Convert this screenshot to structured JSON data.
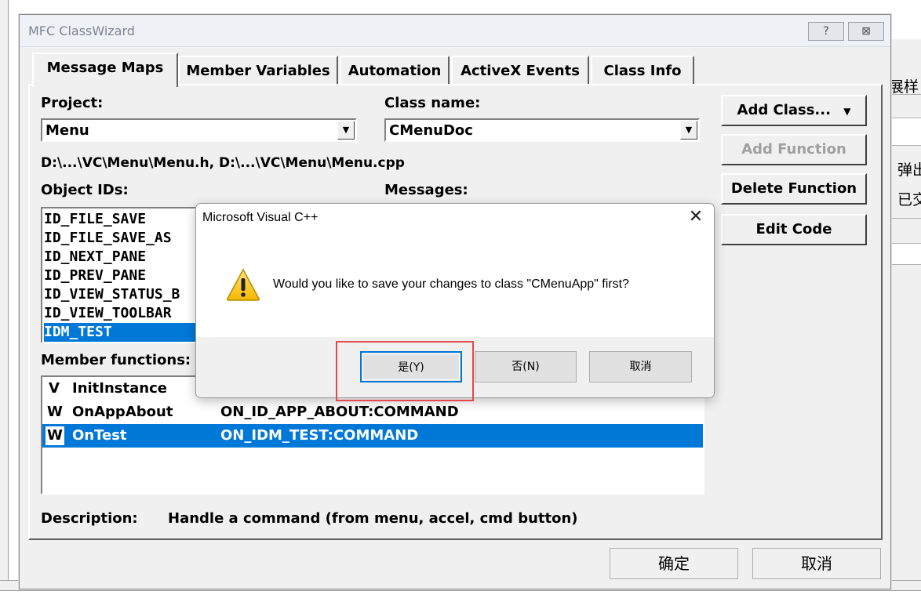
{
  "background": {
    "text_1": "展样",
    "text_2": "弹出",
    "text_3": "已交"
  },
  "wizard": {
    "title": "MFC ClassWizard",
    "help_button": "?",
    "close_button": "⊠",
    "tabs": [
      {
        "label": "Message Maps",
        "active": true
      },
      {
        "label": "Member Variables",
        "active": false
      },
      {
        "label": "Automation",
        "active": false
      },
      {
        "label": "ActiveX Events",
        "active": false
      },
      {
        "label": "Class Info",
        "active": false
      }
    ],
    "project_label": "Project:",
    "project_value": "Menu",
    "class_name_label": "Class name:",
    "class_name_value": "CMenuDoc",
    "file_path": "D:\\...\\VC\\Menu\\Menu.h, D:\\...\\VC\\Menu\\Menu.cpp",
    "object_ids_label": "Object IDs:",
    "messages_label": "Messages:",
    "object_ids": [
      {
        "id": "ID_FILE_SAVE",
        "selected": false
      },
      {
        "id": "ID_FILE_SAVE_AS",
        "selected": false
      },
      {
        "id": "ID_NEXT_PANE",
        "selected": false
      },
      {
        "id": "ID_PREV_PANE",
        "selected": false
      },
      {
        "id": "ID_VIEW_STATUS_B",
        "selected": false
      },
      {
        "id": "ID_VIEW_TOOLBAR",
        "selected": false
      },
      {
        "id": "IDM_TEST",
        "selected": true
      }
    ],
    "member_functions_label": "Member functions:",
    "member_functions": [
      {
        "type": "V",
        "name": "InitInstance",
        "handler": "",
        "selected": false
      },
      {
        "type": "W",
        "name": "OnAppAbout",
        "handler": "ON_ID_APP_ABOUT:COMMAND",
        "selected": false
      },
      {
        "type": "W",
        "name": "OnTest",
        "handler": "ON_IDM_TEST:COMMAND",
        "selected": true
      }
    ],
    "description_label": "Description:",
    "description_value": "Handle a command (from menu, accel, cmd button)",
    "buttons": {
      "add_class": "Add Class...",
      "add_function": "Add Function",
      "delete_function": "Delete Function",
      "edit_code": "Edit Code",
      "ok": "确定",
      "cancel": "取消"
    }
  },
  "dialog": {
    "title": "Microsoft Visual C++",
    "close": "✕",
    "message": "Would you like to save your changes to class \"CMenuApp\" first?",
    "icon": "warning-icon",
    "buttons": {
      "yes": "是(Y)",
      "no": "否(N)",
      "cancel": "取消"
    },
    "highlight_color": "#e34a4a"
  }
}
